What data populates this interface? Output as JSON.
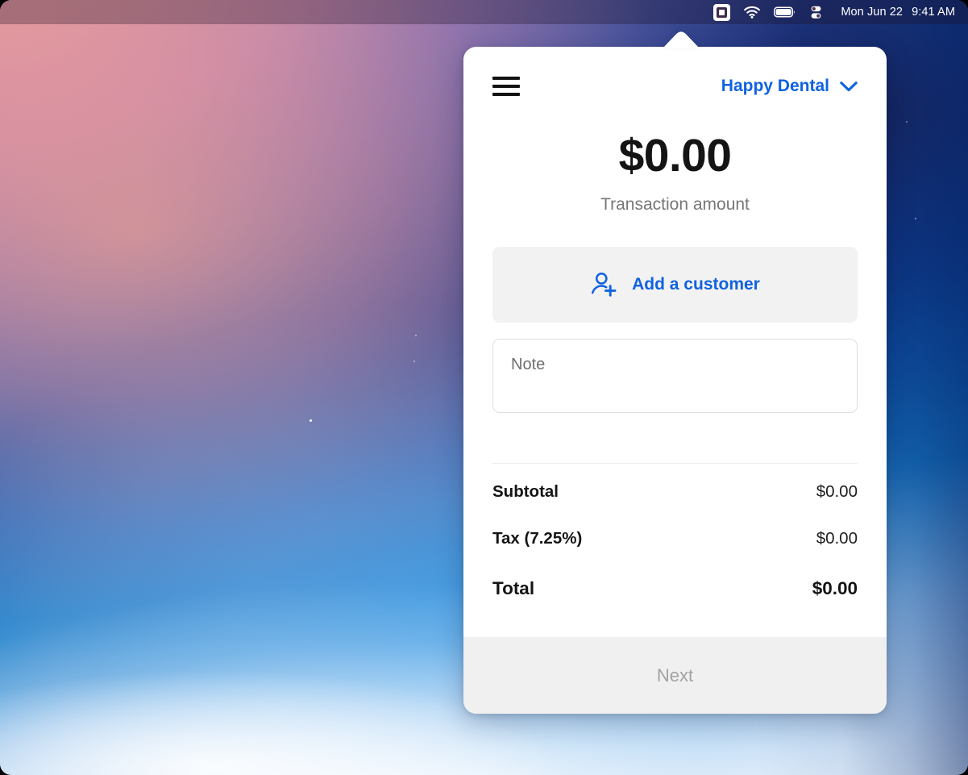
{
  "menubar": {
    "icons": [
      {
        "name": "square-app-icon",
        "glyph": "square"
      },
      {
        "name": "wifi-icon",
        "glyph": "wifi"
      },
      {
        "name": "battery-icon",
        "glyph": "battery"
      },
      {
        "name": "control-center-icon",
        "glyph": "toggles"
      }
    ],
    "date": "Mon Jun 22",
    "time": "9:41 AM"
  },
  "popover": {
    "menu_icon": "hamburger-menu-icon",
    "merchant_name": "Happy Dental",
    "merchant_chevron": "chevron-down-icon",
    "amount": "$0.00",
    "amount_label": "Transaction amount",
    "add_customer": {
      "icon": "person-add-icon",
      "label": "Add a customer"
    },
    "note": {
      "value": "",
      "placeholder": "Note"
    },
    "totals": [
      {
        "label": "Subtotal",
        "value": "$0.00"
      },
      {
        "label": "Tax (7.25%)",
        "value": "$0.00"
      },
      {
        "label": "Total",
        "value": "$0.00"
      }
    ],
    "next_label": "Next"
  },
  "colors": {
    "accent_blue": "#0f62e0",
    "text_primary": "#141414",
    "text_muted": "#767676",
    "button_bg": "#f2f2f2",
    "disabled_text": "#a3a3a3"
  }
}
